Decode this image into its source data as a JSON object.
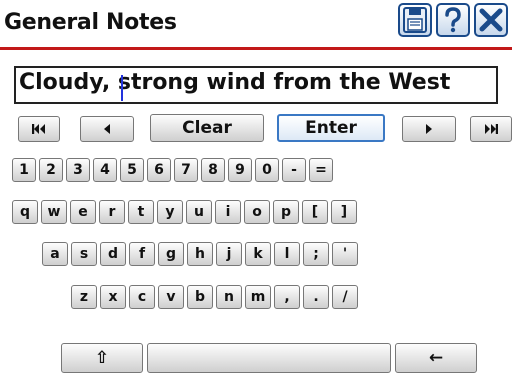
{
  "header": {
    "title": "General Notes",
    "icons": [
      "save-icon",
      "help-icon",
      "close-icon"
    ],
    "accent_color": "#c21818"
  },
  "notes": {
    "value": "Cloudy, strong wind from the West"
  },
  "controls": {
    "first_icon": "skip-to-start-icon",
    "prev_icon": "arrow-left-icon",
    "clear_label": "Clear",
    "enter_label": "Enter",
    "next_icon": "arrow-right-icon",
    "last_icon": "skip-to-end-icon"
  },
  "keyboard": {
    "row1": [
      "1",
      "2",
      "3",
      "4",
      "5",
      "6",
      "7",
      "8",
      "9",
      "0",
      "-",
      "="
    ],
    "row2": [
      "q",
      "w",
      "e",
      "r",
      "t",
      "y",
      "u",
      "i",
      "o",
      "p",
      "[",
      "]"
    ],
    "row3": [
      "a",
      "s",
      "d",
      "f",
      "g",
      "h",
      "j",
      "k",
      "l",
      ";",
      "'"
    ],
    "row4": [
      "z",
      "x",
      "c",
      "v",
      "b",
      "n",
      "m",
      ",",
      ".",
      "/"
    ],
    "shift_label": "⇧",
    "backspace_label": "←"
  }
}
